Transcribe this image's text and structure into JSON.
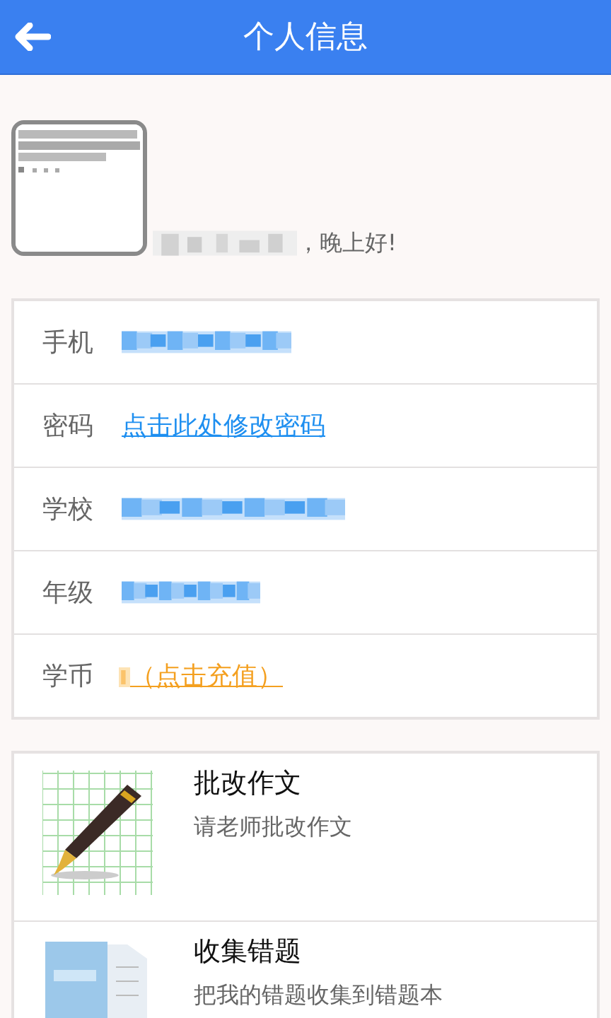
{
  "header": {
    "title": "个人信息"
  },
  "greeting": {
    "text": "，晚上好!"
  },
  "info_rows": [
    {
      "label": "手机",
      "kind": "hidden"
    },
    {
      "label": "密码",
      "kind": "link",
      "value": "点击此处修改密码"
    },
    {
      "label": "学校",
      "kind": "hidden"
    },
    {
      "label": "年级",
      "kind": "hidden"
    },
    {
      "label": "学币",
      "kind": "coins",
      "value": "（点击充值）"
    }
  ],
  "features": [
    {
      "title": "批改作文",
      "subtitle": "请老师批改作文",
      "kind": "essay"
    },
    {
      "title": "收集错题",
      "subtitle": "把我的错题收集到错题本",
      "kind": "notebook"
    }
  ]
}
